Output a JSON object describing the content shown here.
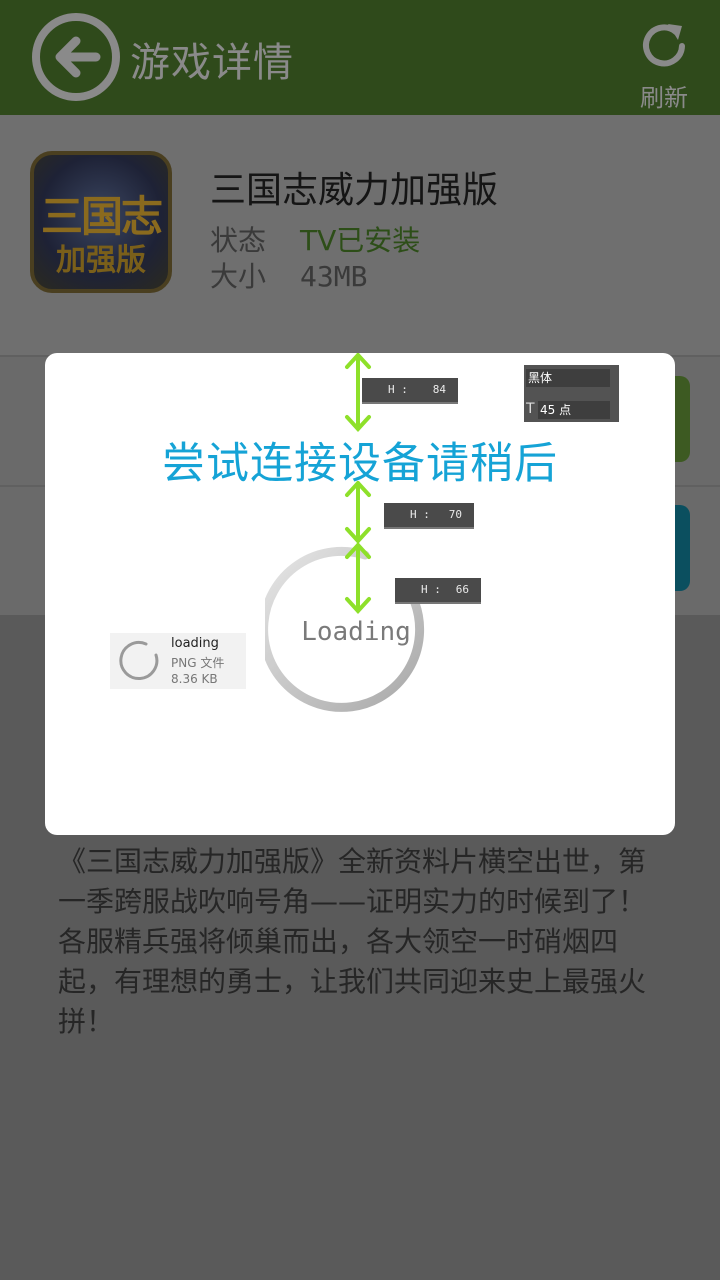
{
  "header": {
    "title": "游戏详情",
    "refresh_label": "刷新",
    "background": "#2f4a1b"
  },
  "app": {
    "icon_line1": "三国志",
    "icon_line2": "加强版",
    "name": "三国志威力加强版",
    "status_label": "状态",
    "status_value": "TV已安装",
    "size_label": "大小",
    "size_value": "43MB"
  },
  "description": "《三国志威力加强版》全新资料片横空出世，第一季跨服战吹响号角——证明实力的时候到了！各服精兵强将倾巢而出，各大领空一时硝烟四起，有理想的勇士，让我们共同迎来史上最强火拼！",
  "dialog": {
    "message": "尝试连接设备请稍后",
    "loading_text": "Loading",
    "message_color": "#15a3d6"
  },
  "annotations": {
    "measure_1": {
      "label": "H :",
      "value": "84"
    },
    "measure_2": {
      "label": "H :",
      "value": "70"
    },
    "measure_3": {
      "label": "H :",
      "value": "66"
    },
    "font_name": "黑体",
    "font_size": "45 点",
    "file_name": "loading",
    "file_type": "PNG 文件",
    "file_size": "8.36 KB",
    "arrow_color": "#8ee02a"
  }
}
